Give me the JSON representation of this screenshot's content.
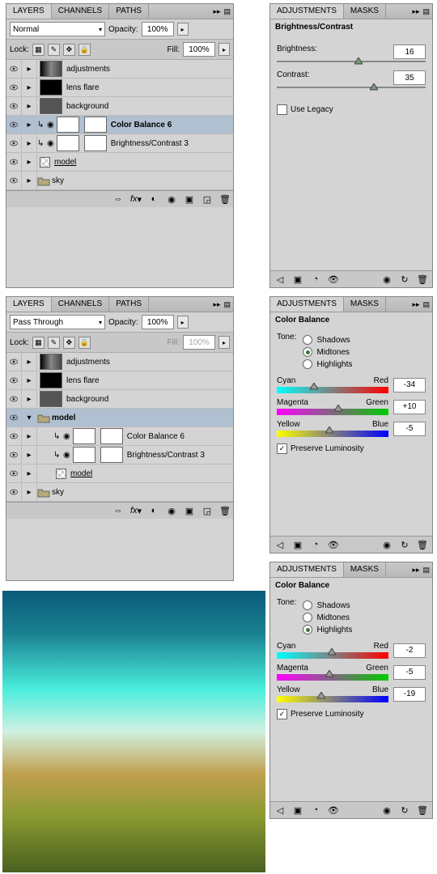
{
  "layers1": {
    "tabs": [
      "LAYERS",
      "CHANNELS",
      "PATHS"
    ],
    "blend": "Normal",
    "opacity_label": "Opacity:",
    "opacity": "100%",
    "lock_label": "Lock:",
    "fill_label": "Fill:",
    "fill": "100%",
    "items": [
      {
        "name": "adjustments",
        "thumb": "gradient"
      },
      {
        "name": "lens flare",
        "thumb": "black"
      },
      {
        "name": "background",
        "thumb": "sky"
      },
      {
        "name": "Color Balance 6",
        "thumb": "white",
        "bold": true,
        "sel": true,
        "mask": true,
        "adj": true
      },
      {
        "name": "Brightness/Contrast 3",
        "thumb": "white",
        "mask": true,
        "adj": true
      },
      {
        "name": "model",
        "thumb": "chk",
        "u": true
      },
      {
        "name": "sky",
        "folder": true
      }
    ]
  },
  "layers2": {
    "tabs": [
      "LAYERS",
      "CHANNELS",
      "PATHS"
    ],
    "blend": "Pass Through",
    "opacity_label": "Opacity:",
    "opacity": "100%",
    "lock_label": "Lock:",
    "fill_label": "Fill:",
    "fill": "100%",
    "items": [
      {
        "name": "adjustments",
        "thumb": "gradient"
      },
      {
        "name": "lens flare",
        "thumb": "black"
      },
      {
        "name": "background",
        "thumb": "sky"
      },
      {
        "name": "model",
        "folder": true,
        "sel": true,
        "bold": true,
        "open": true
      },
      {
        "name": "Color Balance 6",
        "thumb": "white",
        "indent": true,
        "mask": true,
        "adj": true
      },
      {
        "name": "Brightness/Contrast 3",
        "thumb": "white",
        "indent": true,
        "mask": true,
        "adj": true
      },
      {
        "name": "model",
        "thumb": "chk",
        "u": true,
        "indent": true
      },
      {
        "name": "sky",
        "folder": true
      }
    ]
  },
  "adj1": {
    "tabs": [
      "ADJUSTMENTS",
      "MASKS"
    ],
    "title": "Brightness/Contrast",
    "brightness_label": "Brightness:",
    "brightness": "16",
    "contrast_label": "Contrast:",
    "contrast": "35",
    "legacy": "Use Legacy"
  },
  "adj2": {
    "tabs": [
      "ADJUSTMENTS",
      "MASKS"
    ],
    "title": "Color Balance",
    "tone_label": "Tone:",
    "tone": [
      "Shadows",
      "Midtones",
      "Highlights"
    ],
    "tone_sel": 1,
    "cyan": "Cyan",
    "red": "Red",
    "mag": "Magenta",
    "grn": "Green",
    "yel": "Yellow",
    "blu": "Blue",
    "v1": "-34",
    "v2": "+10",
    "v3": "-5",
    "preserve": "Preserve Luminosity"
  },
  "adj3": {
    "tabs": [
      "ADJUSTMENTS",
      "MASKS"
    ],
    "title": "Color Balance",
    "tone_label": "Tone:",
    "tone": [
      "Shadows",
      "Midtones",
      "Highlights"
    ],
    "tone_sel": 2,
    "cyan": "Cyan",
    "red": "Red",
    "mag": "Magenta",
    "grn": "Green",
    "yel": "Yellow",
    "blu": "Blue",
    "v1": "-2",
    "v2": "-5",
    "v3": "-19",
    "preserve": "Preserve Luminosity"
  },
  "chart_data": [
    {
      "type": "bar",
      "title": "Brightness/Contrast",
      "categories": [
        "Brightness",
        "Contrast"
      ],
      "values": [
        16,
        35
      ],
      "ylim": [
        -100,
        100
      ]
    },
    {
      "type": "bar",
      "title": "Color Balance Midtones",
      "categories": [
        "Cyan-Red",
        "Magenta-Green",
        "Yellow-Blue"
      ],
      "values": [
        -34,
        10,
        -5
      ],
      "ylim": [
        -100,
        100
      ]
    },
    {
      "type": "bar",
      "title": "Color Balance Highlights",
      "categories": [
        "Cyan-Red",
        "Magenta-Green",
        "Yellow-Blue"
      ],
      "values": [
        -2,
        -5,
        -19
      ],
      "ylim": [
        -100,
        100
      ]
    }
  ]
}
